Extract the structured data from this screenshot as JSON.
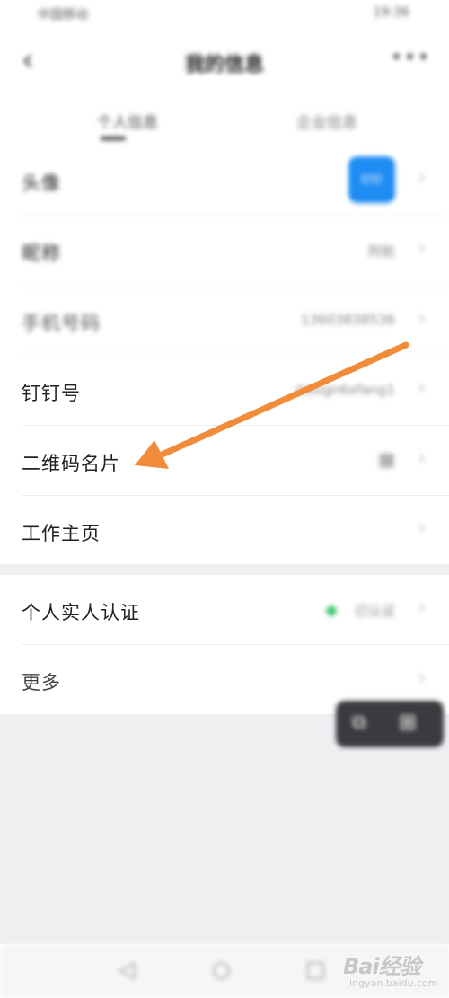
{
  "status_bar": {
    "left_text": "中国移动",
    "right_text": "19:36"
  },
  "nav": {
    "title": "我的信息",
    "back_icon": "‹",
    "more_icon": "•••"
  },
  "tabs": [
    {
      "label": "个人信息"
    },
    {
      "label": "企业信息"
    }
  ],
  "profile_rows": [
    {
      "label": "头像",
      "avatar_text": "钉钉",
      "chevron": "›"
    },
    {
      "label": "昵称",
      "value": "阿航",
      "chevron": "›"
    },
    {
      "label": "手机号码",
      "value": "13603838536",
      "chevron": "›"
    },
    {
      "label": "钉钉号",
      "value": "ddsign6xfang1",
      "chevron": "›"
    },
    {
      "label": "二维码名片",
      "value": "▦",
      "chevron": "›"
    },
    {
      "label": "工作主页",
      "chevron": "›"
    }
  ],
  "auth_rows": [
    {
      "label": "个人实人认证",
      "value": "已认证",
      "chevron": "›"
    },
    {
      "label": "更多",
      "chevron": "›"
    }
  ],
  "floating_widget": {
    "icon_1": "⧉",
    "icon_2": "⊞"
  },
  "system_nav": {
    "back": "◁",
    "home": "○",
    "recent": "□"
  },
  "watermark": {
    "brand": "Bai经验",
    "url": "jingyan.baidu.com"
  },
  "colors": {
    "accent_blue": "#1e8cf3",
    "annotation_arrow": "#f08c3a",
    "verified_green": "#3cc26a"
  }
}
